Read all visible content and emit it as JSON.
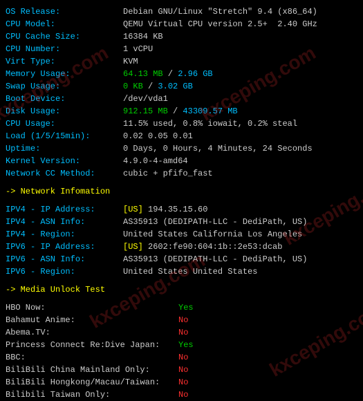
{
  "sys": {
    "os_release": {
      "label": "OS Release:",
      "value": "Debian GNU/Linux \"Stretch\" 9.4 (x86_64)"
    },
    "cpu_model": {
      "label": "CPU Model:",
      "value": "QEMU Virtual CPU version 2.5+  2.40 GHz"
    },
    "cpu_cache": {
      "label": "CPU Cache Size:",
      "value": "16384 KB"
    },
    "cpu_number": {
      "label": "CPU Number:",
      "value": "1 vCPU"
    },
    "virt_type": {
      "label": "Virt Type:",
      "value": "KVM"
    },
    "memory": {
      "label": "Memory Usage:",
      "used": "64.13 MB",
      "sep": " / ",
      "total": "2.96 GB"
    },
    "swap": {
      "label": "Swap Usage:",
      "used": "0 KB",
      "sep": " / ",
      "total": "3.02 GB"
    },
    "boot_device": {
      "label": "Boot Device:",
      "value": "/dev/vda1"
    },
    "disk": {
      "label": "Disk Usage:",
      "used": "912.15 MB",
      "sep": " / ",
      "total": "43309.57 MB"
    },
    "cpu_usage": {
      "label": "CPU Usage:",
      "p1": "11.5% used, ",
      "p2": "0.8% iowait, ",
      "p3": "0.2% steal"
    },
    "load": {
      "label": "Load (1/5/15min):",
      "value": "0.02 0.05 0.01"
    },
    "uptime": {
      "label": "Uptime:",
      "value": "0 Days, 0 Hours, 4 Minutes, 24 Seconds"
    },
    "kernel": {
      "label": "Kernel Version:",
      "value": "4.9.0-4-amd64"
    },
    "cc": {
      "label": "Network CC Method:",
      "value": "cubic + pfifo_fast"
    }
  },
  "net_header": "-> Network Infomation",
  "net": {
    "ipv4_addr": {
      "label": "IPV4 - IP Address:",
      "cc": "[US] ",
      "value": "194.35.15.60"
    },
    "ipv4_asn": {
      "label": "IPV4 - ASN Info:",
      "value": "AS35913 (DEDIPATH-LLC - DediPath, US)"
    },
    "ipv4_region": {
      "label": "IPV4 - Region:",
      "value": "United States California Los Angeles"
    },
    "ipv6_addr": {
      "label": "IPV6 - IP Address:",
      "cc": "[US] ",
      "value": "2602:fe90:604:1b::2e53:dcab"
    },
    "ipv6_asn": {
      "label": "IPV6 - ASN Info:",
      "value": "AS35913 (DEDIPATH-LLC - DediPath, US)"
    },
    "ipv6_region": {
      "label": "IPV6 - Region:",
      "value": "United States United States"
    }
  },
  "media_header": "-> Media Unlock Test",
  "media": [
    {
      "label": "HBO Now:",
      "value": "Yes",
      "status": "green"
    },
    {
      "label": "Bahamut Anime:",
      "value": "No",
      "status": "red"
    },
    {
      "label": "Abema.TV:",
      "value": "No",
      "status": "red"
    },
    {
      "label": "Princess Connect Re:Dive Japan:",
      "value": "Yes",
      "status": "green"
    },
    {
      "label": "BBC:",
      "value": "No",
      "status": "red"
    },
    {
      "label": "BiliBili China Mainland Only:",
      "value": "No",
      "status": "red"
    },
    {
      "label": "BiliBili Hongkong/Macau/Taiwan:",
      "value": "No",
      "status": "red"
    },
    {
      "label": "Bilibili Taiwan Only:",
      "value": "No",
      "status": "red"
    }
  ],
  "watermark": "kxceping.com"
}
